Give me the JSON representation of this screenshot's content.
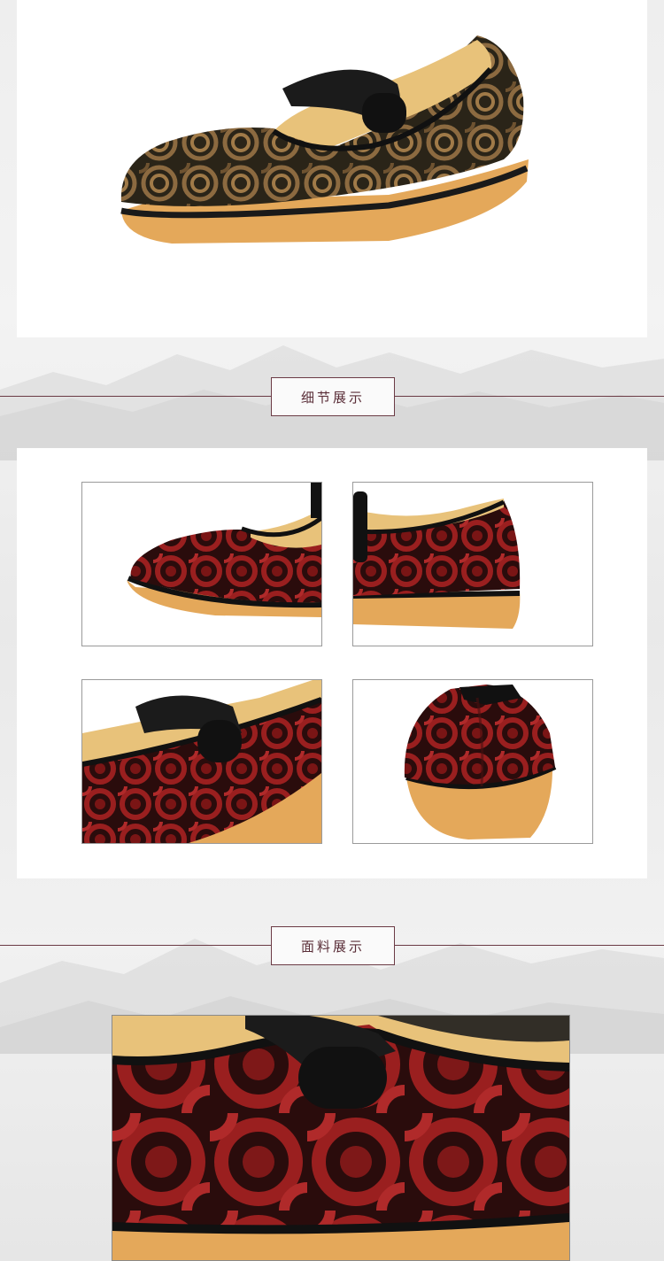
{
  "sections": {
    "detail_title": "细节展示",
    "fabric_title": "面料展示"
  },
  "colors": {
    "accent": "#6b3b45",
    "sole": "#e4a85a",
    "fabric_brown": "#7a5a3a",
    "fabric_red": "#8b1a1a",
    "lining": "#e8c27a"
  },
  "images": {
    "hero": "product-shoe-brown-pattern",
    "detail": [
      "shoe-toe-left-view",
      "shoe-heel-right-view",
      "shoe-strap-closeup",
      "shoe-back-view"
    ],
    "fabric": "fabric-texture-closeup"
  }
}
